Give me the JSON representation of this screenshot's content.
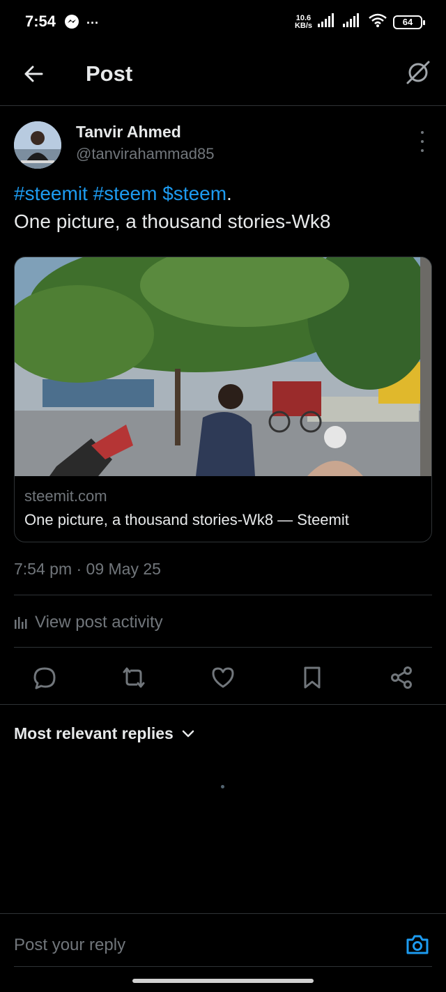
{
  "status_bar": {
    "time": "7:54",
    "notification_icon": "messenger-icon",
    "more_notifications": "···",
    "net_speed_value": "10.6",
    "net_speed_unit": "KB/s",
    "battery_level": "64"
  },
  "header": {
    "title": "Post",
    "back_icon": "arrow-left-icon",
    "grok_icon": "grok-icon"
  },
  "post": {
    "author_name": "Tanvir Ahmed",
    "author_handle": "@tanvirahammad85",
    "text_tags": [
      "#steemit",
      "#steem",
      "$steem"
    ],
    "text_tail": ".",
    "text_line2": "One picture, a thousand stories-Wk8",
    "link_card": {
      "domain": "steemit.com",
      "title": "One picture, a thousand stories-Wk8 — Steemit"
    },
    "timestamp": "7:54 pm · 09 May 25",
    "view_activity": "View post activity",
    "actions": [
      "reply-icon",
      "repost-icon",
      "like-icon",
      "bookmark-icon",
      "share-icon"
    ]
  },
  "replies": {
    "sort_label": "Most relevant replies"
  },
  "reply_bar": {
    "placeholder": "Post your reply"
  },
  "colors": {
    "background": "#000000",
    "text": "#e7e9ea",
    "muted": "#71767b",
    "accent": "#1d9bf0",
    "divider": "#2f3336"
  }
}
